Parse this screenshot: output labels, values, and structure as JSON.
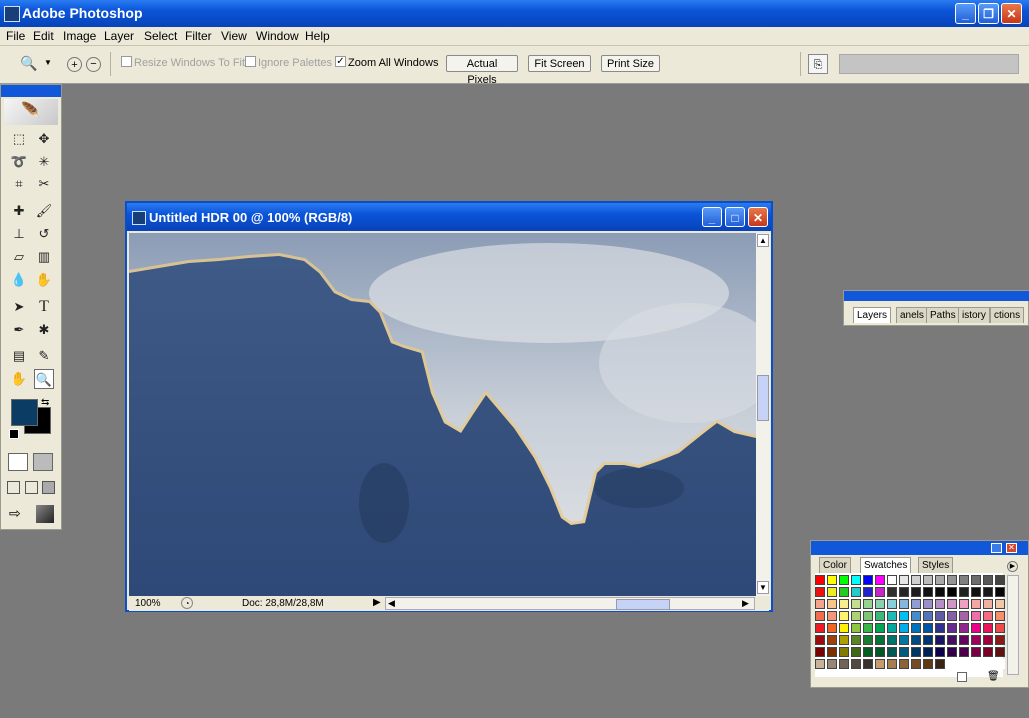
{
  "app": {
    "title": "Adobe Photoshop"
  },
  "menu": [
    "File",
    "Edit",
    "Image",
    "Layer",
    "Select",
    "Filter",
    "View",
    "Window",
    "Help"
  ],
  "options": {
    "resize_windows": "Resize Windows To Fit",
    "ignore_palettes": "Ignore Palettes",
    "zoom_all_windows": "Zoom All Windows",
    "actual_pixels": "Actual Pixels",
    "fit_screen": "Fit Screen",
    "print_size": "Print Size",
    "zoom_all_checked": true
  },
  "document": {
    "title": "Untitled HDR 00 @ 100% (RGB/8)",
    "zoom": "100%",
    "doc_size": "Doc: 28,8M/28,8M"
  },
  "layers_palette": {
    "tabs": [
      "Layers",
      "anels",
      "Paths",
      "istory",
      "ctions"
    ]
  },
  "swatches_palette": {
    "tabs": [
      "Color",
      "Swatches",
      "Styles"
    ]
  },
  "colors": {
    "foreground": "#0b3d64",
    "background": "#000000",
    "title_blue": "#0a54d8"
  }
}
